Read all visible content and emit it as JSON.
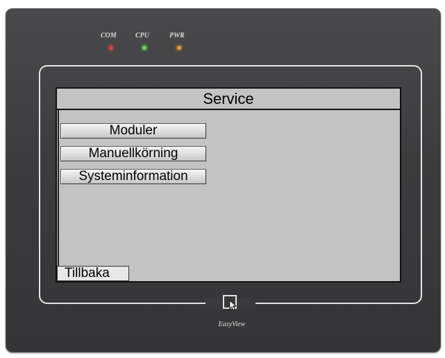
{
  "device": {
    "brand": "EasyView",
    "logo_icon": "touch-hand-icon",
    "leds": [
      {
        "label": "COM",
        "color": "#e83a3a"
      },
      {
        "label": "CPU",
        "color": "#5fd84a"
      },
      {
        "label": "PWR",
        "color": "#f2962a"
      }
    ]
  },
  "screen": {
    "title": "Service",
    "menu_buttons": [
      {
        "label": "Moduler"
      },
      {
        "label": "Manuellkörning"
      },
      {
        "label": "Systeminformation"
      }
    ],
    "back_button": "Tillbaka",
    "background_color": "#c3c3c3"
  }
}
